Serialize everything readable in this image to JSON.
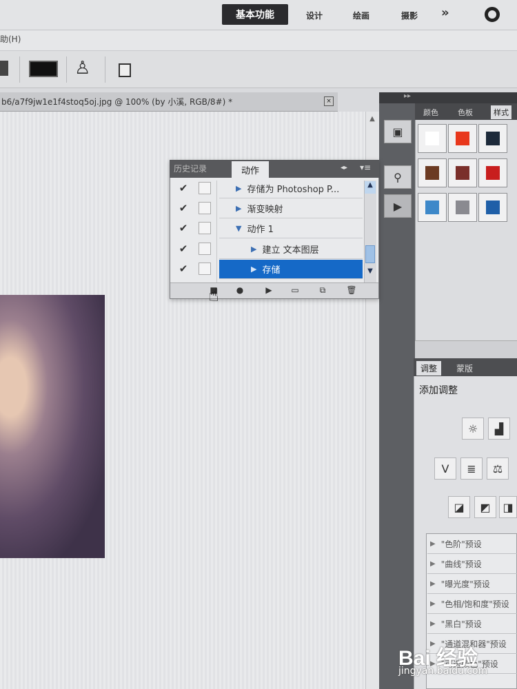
{
  "topbar": {
    "workspaces": [
      "基本功能",
      "设计",
      "绘画",
      "摄影"
    ],
    "more_label": "»",
    "active_index": 0
  },
  "menubar": {
    "item": "助(H)"
  },
  "document": {
    "tab_title": "b6/a7f9jw1e1f4stoq5oj.jpg @ 100% (by 小溪, RGB/8#) *",
    "close_label": "×"
  },
  "actions_panel": {
    "tab_history": "历史记录",
    "tab_actions": "动作",
    "collapse_label": "◂▸",
    "menu_label": "▾≡",
    "rows": [
      {
        "label": "存储为 Photoshop P...",
        "checked": true,
        "expanded": false,
        "indent": 0
      },
      {
        "label": "渐变映射",
        "checked": true,
        "expanded": false,
        "indent": 0
      },
      {
        "label": "动作 1",
        "checked": true,
        "expanded": true,
        "indent": 0
      },
      {
        "label": "建立 文本图层",
        "checked": true,
        "expanded": false,
        "indent": 1
      },
      {
        "label": "存储",
        "checked": true,
        "expanded": false,
        "indent": 1,
        "selected": true
      }
    ],
    "footer_buttons": [
      "stop",
      "record",
      "play",
      "new-set",
      "new-action",
      "delete"
    ]
  },
  "styles_panel": {
    "tabs": [
      "颜色",
      "色板",
      "样式"
    ],
    "swatch_colors": [
      "#ffffff",
      "#e8371c",
      "#1d2a3a",
      "#6b3a22",
      "#7a2f2a",
      "#c81e1e",
      "#3d88c9",
      "#8a8a90",
      "#1f5fa8"
    ]
  },
  "adjustments_panel": {
    "tabs": [
      "调整",
      "蒙版"
    ],
    "add_label": "添加调整",
    "presets": [
      "\"色阶\"预设",
      "\"曲线\"预设",
      "\"曝光度\"预设",
      "\"色相/饱和度\"预设",
      "\"黑白\"预设",
      "\"通道混和器\"预设",
      "\"可选颜色\"预设"
    ]
  },
  "watermark": {
    "brand": "Bai 经验",
    "sub": "jingyan.baidu.com"
  },
  "colors": {
    "selection": "#1569c7",
    "dock": "#5d5f63"
  }
}
